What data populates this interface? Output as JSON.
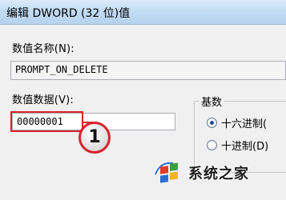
{
  "window": {
    "title": "编辑 DWORD (32 位)值"
  },
  "value_name": {
    "label": "数值名称(N):",
    "value": "PROMPT_ON_DELETE"
  },
  "value_data": {
    "label": "数值数据(V):",
    "value": "00000001"
  },
  "base": {
    "title": "基数",
    "options": [
      {
        "label": "十六进制(",
        "checked": true
      },
      {
        "label": "十进制(D)",
        "checked": false
      }
    ]
  },
  "annotation": {
    "number": "1",
    "color": "#d9232c"
  },
  "watermark": {
    "text": "系统之家",
    "logo_icon": "windows-logo-icon"
  }
}
